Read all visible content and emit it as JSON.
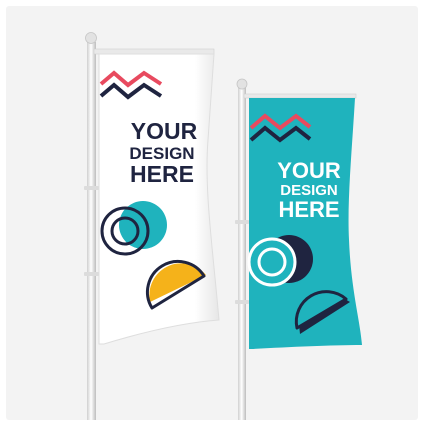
{
  "scene": {
    "colors": {
      "background": "#f3f3f3",
      "pole": "#e4e4e4",
      "pole_shadow": "#c9c9c9",
      "white_flag": "#ffffff",
      "teal_flag": "#1fb3bd",
      "navy": "#1f2440",
      "coral": "#e84a5f",
      "yellow": "#f5b21a",
      "white_text": "#ffffff"
    },
    "flag_left": {
      "line1": "YOUR",
      "line2": "DESIGN",
      "line3": "HERE"
    },
    "flag_right": {
      "line1": "YOUR",
      "line2": "DESIGN",
      "line3": "HERE"
    }
  }
}
